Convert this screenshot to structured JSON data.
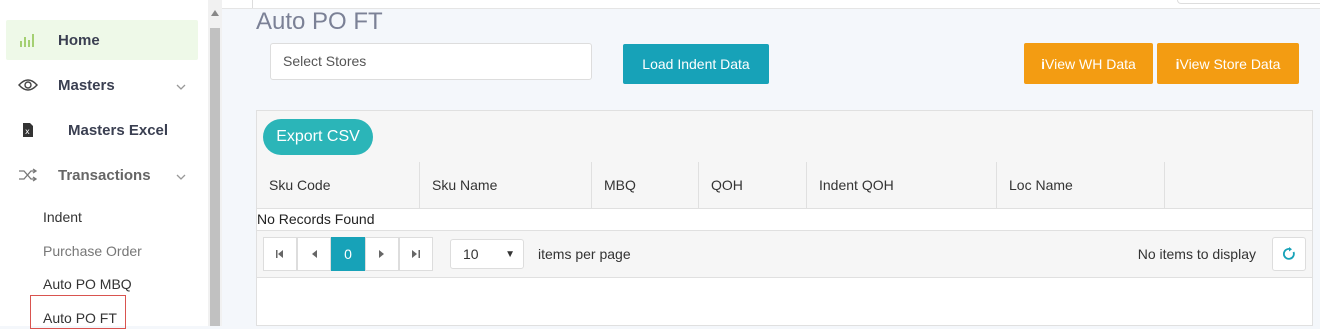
{
  "sidebar": {
    "items": [
      {
        "label": "Home",
        "icon": "bar-chart-icon"
      },
      {
        "label": "Masters",
        "icon": "eye-icon"
      },
      {
        "label": "Masters Excel",
        "icon": "excel-file-icon"
      },
      {
        "label": "Transactions",
        "icon": "shuffle-icon"
      }
    ],
    "subitems": [
      "Indent",
      "Purchase Order",
      "Auto PO MBQ",
      "Auto PO FT"
    ]
  },
  "page": {
    "title": "Auto PO FT"
  },
  "filters": {
    "store_placeholder": "Select Stores"
  },
  "buttons": {
    "load": "Load Indent Data",
    "wh": "View WH Data",
    "store": "View Store Data",
    "info_glyph": "i"
  },
  "grid": {
    "export_label": "Export CSV",
    "columns": [
      "Sku Code",
      "Sku Name",
      "MBQ",
      "QOH",
      "Indent QOH",
      "Loc Name"
    ],
    "empty_message": "No Records Found"
  },
  "pager": {
    "current_page": "0",
    "page_size": "10",
    "items_per_page_label": "items per page",
    "status": "No items to display"
  },
  "colors": {
    "teal": "#17a2b8",
    "orange": "#f39c12",
    "active_bg": "#eef9e8"
  }
}
